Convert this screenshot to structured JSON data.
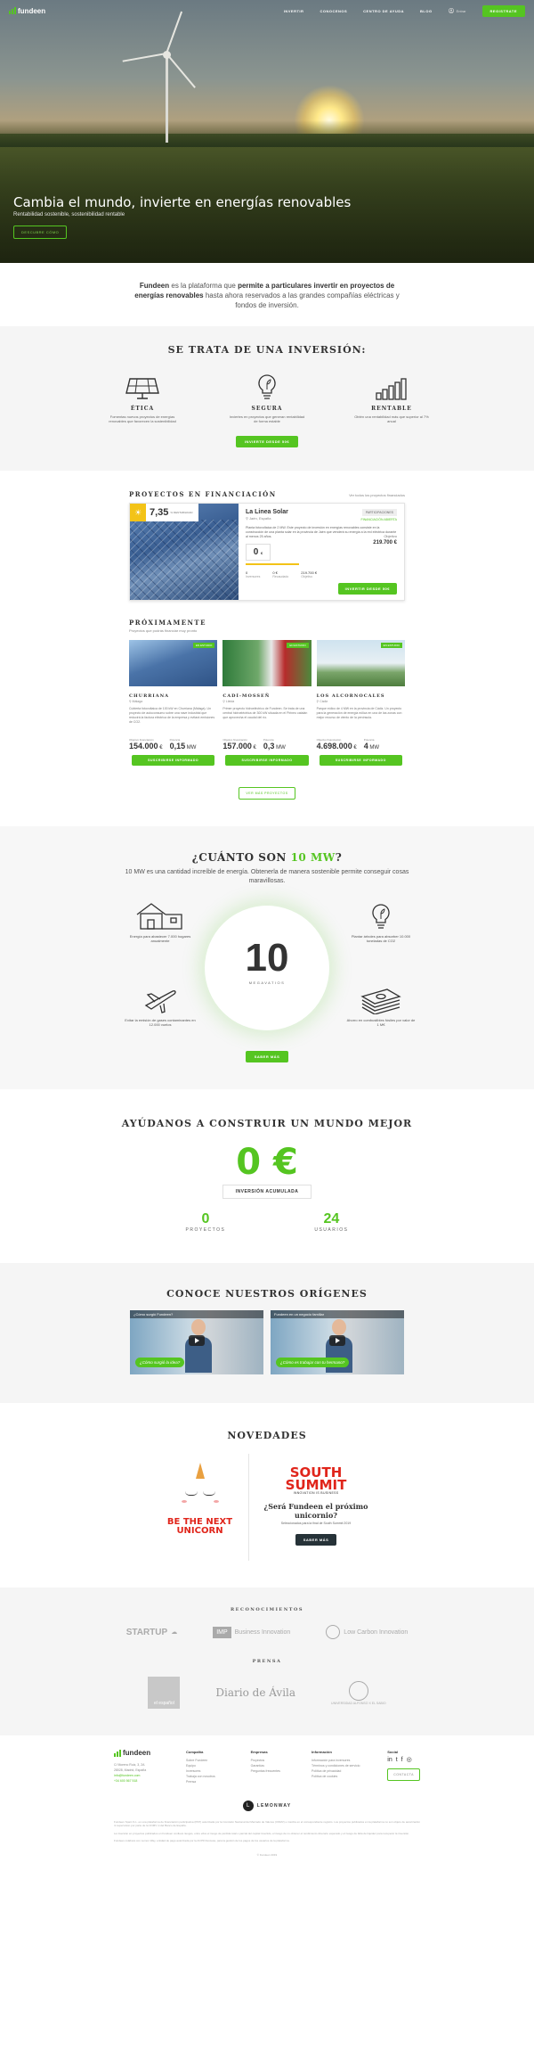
{
  "nav": {
    "brand": "fundeen",
    "items": [
      "INVERTIR",
      "CONOCENOS",
      "CENTRO DE AYUDA",
      "BLOG"
    ],
    "login": "Entrar",
    "register": "REGISTRATE"
  },
  "hero": {
    "title": "Cambia el mundo, invierte en energías renovables",
    "subtitle": "Rentabilidad sostenible, sostenibilidad rentable",
    "button": "DESCUBRE CÓMO"
  },
  "intro": {
    "p1": "Fundeen",
    "p2": " es la plataforma que ",
    "p3": "permite a particulares invertir en proyectos de energías renovables",
    "p4": " hasta ahora reservados a las grandes compañías eléctricas y fondos de inversión."
  },
  "inversion": {
    "title": "SE TRATA DE UNA INVERSIÓN:",
    "features": [
      {
        "title": "ÉTICA",
        "text": "Fomentas nuevos proyectos de energías renovables que favorecen la sostenibilidad"
      },
      {
        "title": "SEGURA",
        "text": "Inviertes en proyectos que generan rentabilidad de forma estable"
      },
      {
        "title": "RENTABLE",
        "text": "Obtén una rentabilidad más que superior al 7% anual"
      }
    ],
    "button": "INVIERTE DESDE 50€"
  },
  "projects": {
    "title": "PROYECTOS EN FINANCIACIÓN",
    "note": "Ver todos los proyectos financiados",
    "featured": {
      "rentabilidad": "7,35",
      "rent_unit": "% RENTABILIDAD",
      "name": "La Linea Solar",
      "location": "Jaén, España",
      "desc": "Planta fotovoltaica de 2 MW. Este proyecto de inversión en energías renovables consiste en la construcción de una planta solar en la provincia de Jaén que venderá su energía a la red eléctrica durante al menos 25 años.",
      "tag": "PARTICIPACIONES",
      "tag2": "FINANCIACIÓN ABIERTA",
      "obj_label": "Objetivo",
      "obj": "219.700 €",
      "invested": "0",
      "unit": "€",
      "stats": [
        {
          "value": "0",
          "label": "Inversores"
        },
        {
          "value": "0 €",
          "label": "Recaudado"
        },
        {
          "value": "219.700 €",
          "label": "Objetivo"
        }
      ],
      "button": "INVERTIR DESDE 50€"
    },
    "soon_title": "PRÓXIMAMENTE",
    "soon_note": "Proyectos que podrás financiar muy pronto",
    "soon": [
      {
        "badge": "EN ESTUDIO",
        "name": "CHURRIANA",
        "loc": "Málaga",
        "desc": "Cubierta fotovoltaica de 100 kW en Churriana (Málaga). Un proyecto de autoconsumo sobre una nave industrial que reducirá la factura eléctrica de la empresa y evitará emisiones de CO2.",
        "amount": "154.000",
        "amount_unit": "€",
        "power": "0,15",
        "power_unit": "MW",
        "a_label": "Objetivo financiación",
        "p_label": "Potencia",
        "button": "SUSCRIBIRSE INFORMADO"
      },
      {
        "badge": "EN ESTUDIO",
        "name": "CADÍ-MOSSEÑ",
        "loc": "Lleida",
        "desc": "Primer proyecto hidroeléctrico de Fundeen. Se trata de una central hidroeléctrica de 300 kW situada en el Pirineo catalán que aprovecha el caudal del río.",
        "amount": "157.000",
        "amount_unit": "€",
        "power": "0,3",
        "power_unit": "MW",
        "a_label": "Objetivo financiación",
        "p_label": "Potencia",
        "button": "SUSCRIBIRSE INFORMADO"
      },
      {
        "badge": "EN ESTUDIO",
        "name": "LOS ALCORNOCALES",
        "loc": "Cádiz",
        "desc": "Parque eólico de 4 MW en la provincia de Cádiz. Un proyecto para la generación de energía eólica en una de las zonas con mejor recurso de viento de la península.",
        "amount": "4.698.000",
        "amount_unit": "€",
        "power": "4",
        "power_unit": "MW",
        "a_label": "Objetivo financiación",
        "p_label": "Potencia",
        "button": "SUSCRIBIRSE INFORMADO"
      }
    ],
    "more": "VER MÁS PROYECTOS"
  },
  "mw": {
    "title_a": "¿CUÁNTO SON ",
    "title_b": "10 MW",
    "title_c": "?",
    "lead": "10 MW es una cantidad increíble de energía. Obtenerla de manera sostenible permite conseguir cosas maravillosas.",
    "big": "10",
    "unit": "MEGAVATIOS",
    "items": [
      "Energía para abastecer 7.000 hogares anualmente",
      "Evitar la emisión de gases contaminantes en 12.000 vuelos",
      "Plantar árboles para absorber 10.000 toneladas de CO2",
      "Ahorro en combustibles fósiles por valor de 1 M€"
    ],
    "button": "SABER MÁS"
  },
  "build": {
    "title": "AYÚDANOS A CONSTRUIR UN MUNDO MEJOR",
    "amount": "0 €",
    "amount_label": "INVERSIÓN ACUMULADA",
    "s1": "0",
    "s1_label": "PROYECTOS",
    "s2": "24",
    "s2_label": "USUARIOS"
  },
  "orig": {
    "title": "CONOCE NUESTROS ORÍGENES",
    "videos": [
      {
        "title": "¿Cómo surgió Fundeen?",
        "quote": "¿Cómo surgió la idea?"
      },
      {
        "title": "Fundeen en un negocio familiar",
        "quote": "¿Cómo es trabajar con tu hermano?"
      }
    ]
  },
  "nov": {
    "title": "NOVEDADES",
    "uni_a": "BE THE NEXT",
    "uni_b": "UNICORN",
    "ss_a": "SOUTH",
    "ss_b": "SUMMIT",
    "ss_c": "INNOVATION IS BUSINESS",
    "q": "¿Será Fundeen el próximo unicornio?",
    "p": "Seleccionados para la final de South Summit 2019",
    "button": "SABER MÁS"
  },
  "recon": {
    "title": "RECONOCIMIENTOS",
    "logos": [
      "STARTUP",
      "Business Innovation",
      "Low Carbon Innovation"
    ],
    "press_title": "PRENSA",
    "press": [
      "el español",
      "Diario de Ávila",
      "UNIVERSIDAD ALFONSO X EL SABIO"
    ]
  },
  "footer": {
    "brand": "fundeen",
    "address": [
      "C/ Moreno Ruiz, 3, 2A",
      "28028, Madrid, España"
    ],
    "email": "info@fundeen.com",
    "phone": "+34 600 567 518",
    "cols": [
      {
        "title": "Compañía",
        "links": [
          "Sobre Fundeen",
          "Equipo",
          "Inversores",
          "Trabaja con nosotros",
          "Prensa"
        ]
      },
      {
        "title": "Empresas",
        "links": [
          "Proyectos",
          "Garantías",
          "Preguntas frecuentes"
        ]
      },
      {
        "title": "Información",
        "links": [
          "Información para inversores",
          "Términos y condiciones de servicio",
          "Política de privacidad",
          "Política de cookies"
        ]
      }
    ],
    "social_title": "Social",
    "social": [
      "in",
      "t",
      "f",
      "◎"
    ],
    "social_btn": "CONTACTA",
    "lemon": "LEMONWAY",
    "legal": [
      "Fundeen Spain S.L. es una plataforma de financiación participativa (PFP) autorizada por la Comisión Nacional del Mercado de Valores (CNMV) e inscrita en el correspondiente registro. Los proyectos publicados en la plataforma no son objeto de autorización ni supervisión por parte de la CNMV ni del Banco de España.",
      "La inversión en proyectos publicados en Fundeen conlleva riesgos, entre ellos el riesgo de pérdida total o parcial del capital invertido, el riesgo de no obtener el rendimiento dinerario esperado y el riesgo de falta de liquidez para recuperar la inversión.",
      "Fundeen colabora con Lemon Way, entidad de pago autorizada por la ACPR francesa, para la gestión de los pagos de los usuarios de la plataforma."
    ],
    "copy": "© Fundeen 2019"
  }
}
